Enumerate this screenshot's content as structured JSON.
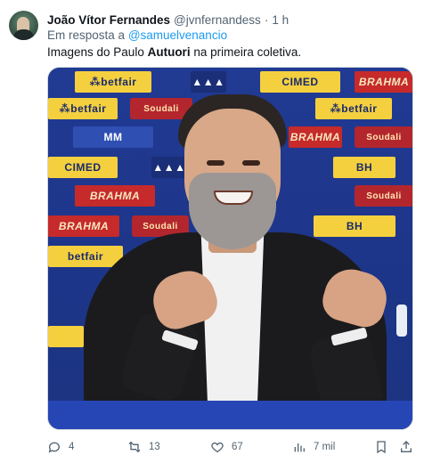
{
  "tweet": {
    "author_name": "João Vítor Fernandes",
    "author_handle": "@jvnfernandess",
    "separator": "·",
    "time": "1 h",
    "reply_prefix": "Em resposta a",
    "reply_to": "@samuelvenancio",
    "text_before": "Imagens do Paulo ",
    "text_bold": "Autuori",
    "text_after": " na primeira coletiva."
  },
  "media": {
    "sponsors": {
      "betfair": "⁂betfair",
      "betfair_b": "betfair",
      "cimed": "CIMED",
      "brahma": "BRAHMA",
      "soudali": "Soudali",
      "bh": "BH",
      "mm": "MM"
    }
  },
  "actions": {
    "replies": "4",
    "retweets": "13",
    "likes": "67",
    "views": "7 mil"
  },
  "icons": {
    "reply": "reply-icon",
    "retweet": "retweet-icon",
    "like": "heart-icon",
    "views": "views-chart-icon",
    "bookmark": "bookmark-icon",
    "share": "share-icon"
  },
  "colors": {
    "accent": "#1d9bf0",
    "secondary_text": "#536471",
    "primary_text": "#0f1419"
  }
}
